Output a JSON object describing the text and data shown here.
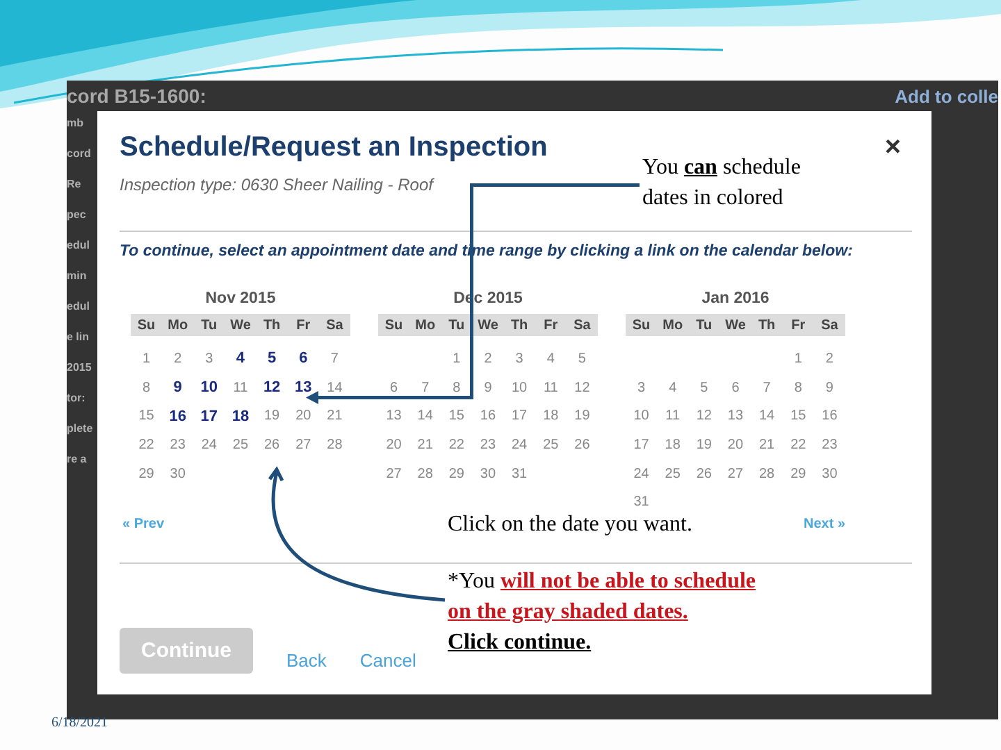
{
  "background_page": {
    "title_fragment": "cord B15-1600:",
    "link_fragment": "Add to colle",
    "side_fragments": [
      "mb",
      "cord",
      "Re",
      "pec",
      "edul",
      "min",
      "edul",
      "e lin",
      "2015",
      "tor:",
      "plete",
      "re a"
    ]
  },
  "dialog": {
    "title": "Schedule/Request an Inspection",
    "close": "×",
    "inspection_type": "Inspection type: 0630 Sheer Nailing - Roof",
    "instruction": "To continue, select an appointment date and time range by clicking a link on the calendar below:",
    "months": [
      {
        "title": "Nov 2015",
        "weekdays": [
          "Su",
          "Mo",
          "Tu",
          "We",
          "Th",
          "Fr",
          "Sa"
        ],
        "weeks": [
          [
            {
              "day": "1",
              "available": false
            },
            {
              "day": "2",
              "available": false
            },
            {
              "day": "3",
              "available": false
            },
            {
              "day": "4",
              "available": true
            },
            {
              "day": "5",
              "available": true
            },
            {
              "day": "6",
              "available": true
            },
            {
              "day": "7",
              "available": false
            }
          ],
          [
            {
              "day": "8",
              "available": false
            },
            {
              "day": "9",
              "available": true
            },
            {
              "day": "10",
              "available": true
            },
            {
              "day": "11",
              "available": false
            },
            {
              "day": "12",
              "available": true
            },
            {
              "day": "13",
              "available": true
            },
            {
              "day": "14",
              "available": false
            }
          ],
          [
            {
              "day": "15",
              "available": false
            },
            {
              "day": "16",
              "available": true
            },
            {
              "day": "17",
              "available": true
            },
            {
              "day": "18",
              "available": true
            },
            {
              "day": "19",
              "available": false
            },
            {
              "day": "20",
              "available": false
            },
            {
              "day": "21",
              "available": false
            }
          ],
          [
            {
              "day": "22",
              "available": false
            },
            {
              "day": "23",
              "available": false
            },
            {
              "day": "24",
              "available": false
            },
            {
              "day": "25",
              "available": false
            },
            {
              "day": "26",
              "available": false
            },
            {
              "day": "27",
              "available": false
            },
            {
              "day": "28",
              "available": false
            }
          ],
          [
            {
              "day": "29",
              "available": false
            },
            {
              "day": "30",
              "available": false
            }
          ]
        ]
      },
      {
        "title": "Dec 2015",
        "weekdays": [
          "Su",
          "Mo",
          "Tu",
          "We",
          "Th",
          "Fr",
          "Sa"
        ],
        "weeks": [
          [
            {
              "day": "1",
              "available": false
            },
            {
              "day": "2",
              "available": false
            },
            {
              "day": "3",
              "available": false
            },
            {
              "day": "4",
              "available": false
            },
            {
              "day": "5",
              "available": false
            }
          ],
          [
            {
              "day": "6",
              "available": false
            },
            {
              "day": "7",
              "available": false
            },
            {
              "day": "8",
              "available": false
            },
            {
              "day": "9",
              "available": false
            },
            {
              "day": "10",
              "available": false
            },
            {
              "day": "11",
              "available": false
            },
            {
              "day": "12",
              "available": false
            }
          ],
          [
            {
              "day": "13",
              "available": false
            },
            {
              "day": "14",
              "available": false
            },
            {
              "day": "15",
              "available": false
            },
            {
              "day": "16",
              "available": false
            },
            {
              "day": "17",
              "available": false
            },
            {
              "day": "18",
              "available": false
            },
            {
              "day": "19",
              "available": false
            }
          ],
          [
            {
              "day": "20",
              "available": false
            },
            {
              "day": "21",
              "available": false
            },
            {
              "day": "22",
              "available": false
            },
            {
              "day": "23",
              "available": false
            },
            {
              "day": "24",
              "available": false
            },
            {
              "day": "25",
              "available": false
            },
            {
              "day": "26",
              "available": false
            }
          ],
          [
            {
              "day": "27",
              "available": false
            },
            {
              "day": "28",
              "available": false
            },
            {
              "day": "29",
              "available": false
            },
            {
              "day": "30",
              "available": false
            },
            {
              "day": "31",
              "available": false
            }
          ]
        ]
      },
      {
        "title": "Jan 2016",
        "weekdays": [
          "Su",
          "Mo",
          "Tu",
          "We",
          "Th",
          "Fr",
          "Sa"
        ],
        "weeks": [
          [
            {
              "day": "1",
              "available": false
            },
            {
              "day": "2",
              "available": false
            }
          ],
          [
            {
              "day": "3",
              "available": false
            },
            {
              "day": "4",
              "available": false
            },
            {
              "day": "5",
              "available": false
            },
            {
              "day": "6",
              "available": false
            },
            {
              "day": "7",
              "available": false
            },
            {
              "day": "8",
              "available": false
            },
            {
              "day": "9",
              "available": false
            }
          ],
          [
            {
              "day": "10",
              "available": false
            },
            {
              "day": "11",
              "available": false
            },
            {
              "day": "12",
              "available": false
            },
            {
              "day": "13",
              "available": false
            },
            {
              "day": "14",
              "available": false
            },
            {
              "day": "15",
              "available": false
            },
            {
              "day": "16",
              "available": false
            }
          ],
          [
            {
              "day": "17",
              "available": false
            },
            {
              "day": "18",
              "available": false
            },
            {
              "day": "19",
              "available": false
            },
            {
              "day": "20",
              "available": false
            },
            {
              "day": "21",
              "available": false
            },
            {
              "day": "22",
              "available": false
            },
            {
              "day": "23",
              "available": false
            }
          ],
          [
            {
              "day": "24",
              "available": false
            },
            {
              "day": "25",
              "available": false
            },
            {
              "day": "26",
              "available": false
            },
            {
              "day": "27",
              "available": false
            },
            {
              "day": "28",
              "available": false
            },
            {
              "day": "29",
              "available": false
            },
            {
              "day": "30",
              "available": false
            }
          ],
          [
            {
              "day": "31",
              "available": false
            }
          ]
        ]
      }
    ],
    "prev": "« Prev",
    "next": "Next »",
    "continue": {
      "label": "Continue",
      "disabled": true
    },
    "back": "Back",
    "cancel": "Cancel"
  },
  "notes": [
    {
      "segments": [
        {
          "text": "You ",
          "kind": "plain"
        },
        {
          "text": "can",
          "kind": "underline"
        },
        {
          "text": " schedule dates in colored",
          "kind": "plain"
        }
      ]
    },
    {
      "segments": [
        {
          "text": "Click on the date you want.",
          "kind": "plain"
        }
      ]
    },
    {
      "segments": [
        {
          "text": "*You ",
          "kind": "plain"
        },
        {
          "text": "will not be able to schedule on the gray shaded dates.",
          "kind": "warning"
        },
        {
          "text": "Click continue.",
          "kind": "emphasis"
        }
      ]
    }
  ],
  "footer_date": "6/18/2021"
}
